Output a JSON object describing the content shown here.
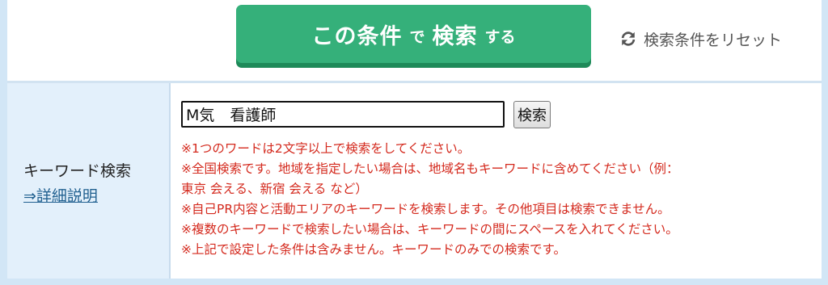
{
  "search_form": {
    "submit_button": {
      "part1": "この条件",
      "part2": "で",
      "part3": "検索",
      "part4": "する"
    },
    "reset_label": "検索条件をリセット",
    "reset_icon": "refresh-icon"
  },
  "keyword_row": {
    "label": "キーワード検索",
    "detail_link": "⇒詳細説明",
    "input_value": "M気　看護師",
    "search_button_label": "検索",
    "notes": [
      "※1つのワードは2文字以上で検索をしてください。",
      "※全国検索です。地域を指定したい場合は、地域名もキーワードに含めてください（例：",
      "東京 会える、新宿 会える など）",
      "※自己PR内容と活動エリアのキーワードを検索します。その他項目は検索できません。",
      "※複数のキーワードで検索したい場合は、キーワードの間にスペースを入れてください。",
      "※上記で設定した条件は含みません。キーワードのみでの検索です。"
    ]
  },
  "colors": {
    "submit_green": "#35b07a",
    "submit_shadow": "#1e8a59",
    "note_red": "#d42a1e",
    "label_bg": "#e3f0fb",
    "link_blue": "#1f5f8f"
  }
}
